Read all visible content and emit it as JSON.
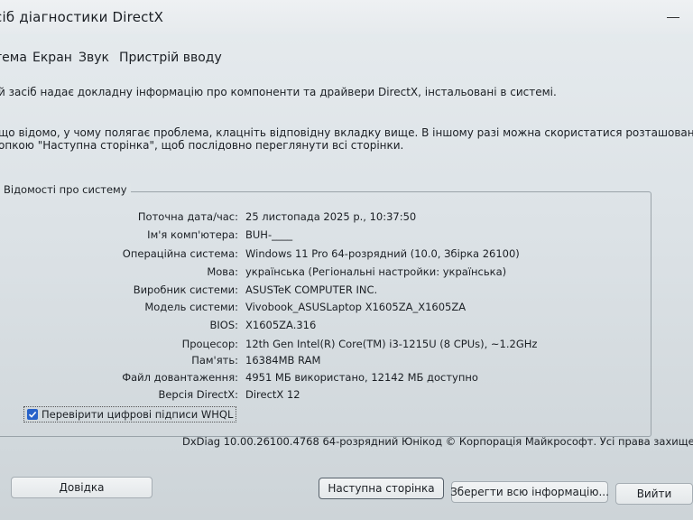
{
  "window": {
    "title": "сіб діагностики DirectX"
  },
  "tabs": [
    {
      "label": "тема"
    },
    {
      "label": "Екран"
    },
    {
      "label": "Звук"
    },
    {
      "label": "Пристрій вводу"
    }
  ],
  "intro": {
    "line1": "й засіб надає докладну інформацію про компоненти та драйвери DirectX, інстальовані в системі.",
    "line2": "що відомо, у чому полягає проблема, клацніть відповідну вкладку вище. В іншому разі можна скористатися розташованою нижче",
    "line3": "опкою \"Наступна сторінка\", щоб послідовно переглянути всі сторінки."
  },
  "system_info": {
    "group_title": "Відомості про систему",
    "rows": [
      {
        "label": "Поточна дата/час:",
        "value": "25 листопада 2025 р., 10:37:50"
      },
      {
        "label": "Ім'я комп'ютера:",
        "value": "BUH-____"
      },
      {
        "label": "Операційна система:",
        "value": "Windows 11 Pro 64-розрядний (10.0, Збірка 26100)"
      },
      {
        "label": "Мова:",
        "value": "українська (Регіональні настройки: українська)"
      },
      {
        "label": "Виробник системи:",
        "value": "ASUSTeK COMPUTER INC."
      },
      {
        "label": "Модель системи:",
        "value": "Vivobook_ASUSLaptop X1605ZA_X1605ZA"
      },
      {
        "label": "BIOS:",
        "value": "X1605ZA.316"
      },
      {
        "label": "Процесор:",
        "value": "12th Gen Intel(R) Core(TM) i3-1215U (8 CPUs), ~1.2GHz"
      },
      {
        "label": "Пам'ять:",
        "value": "16384MB RAM"
      },
      {
        "label": "Файл довантаження:",
        "value": "4951 МБ використано, 12142 МБ доступно"
      },
      {
        "label": "Версія DirectX:",
        "value": "DirectX 12"
      }
    ]
  },
  "whql": {
    "label": "Перевірити цифрові підписи WHQL",
    "checked": true
  },
  "footer": {
    "text": "DxDiag 10.00.26100.4768 64-розрядний Юнікод  © Корпорація Майкрософт. Усі права захищені."
  },
  "buttons": {
    "help": "Довідка",
    "next_page": "Наступна сторінка",
    "save_all": "Зберегти всю інформацію...",
    "exit": "Вийти"
  }
}
